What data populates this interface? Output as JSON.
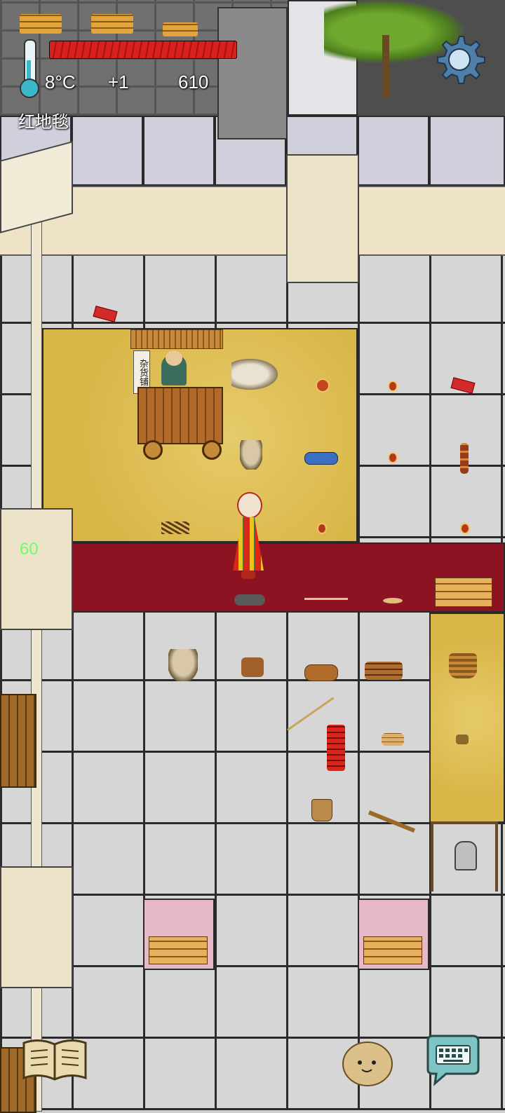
{
  "hud": {
    "temperature": "8°C",
    "temp_change": "+1",
    "score": "610",
    "health_level": 1.0,
    "item_name": "红地毯",
    "side_counter": "60"
  },
  "shop_sign": "杂货铺",
  "icons": {
    "settings": "gear-icon",
    "journal": "book-icon",
    "emote": "potato-face-icon",
    "chat": "keyboard-chat-icon",
    "thermometer": "thermometer-icon"
  },
  "colors": {
    "health": "#d8201f",
    "counter": "#6bff6b",
    "carpet_red": "#8d1222",
    "carpet_yellow": "#d9b648"
  }
}
